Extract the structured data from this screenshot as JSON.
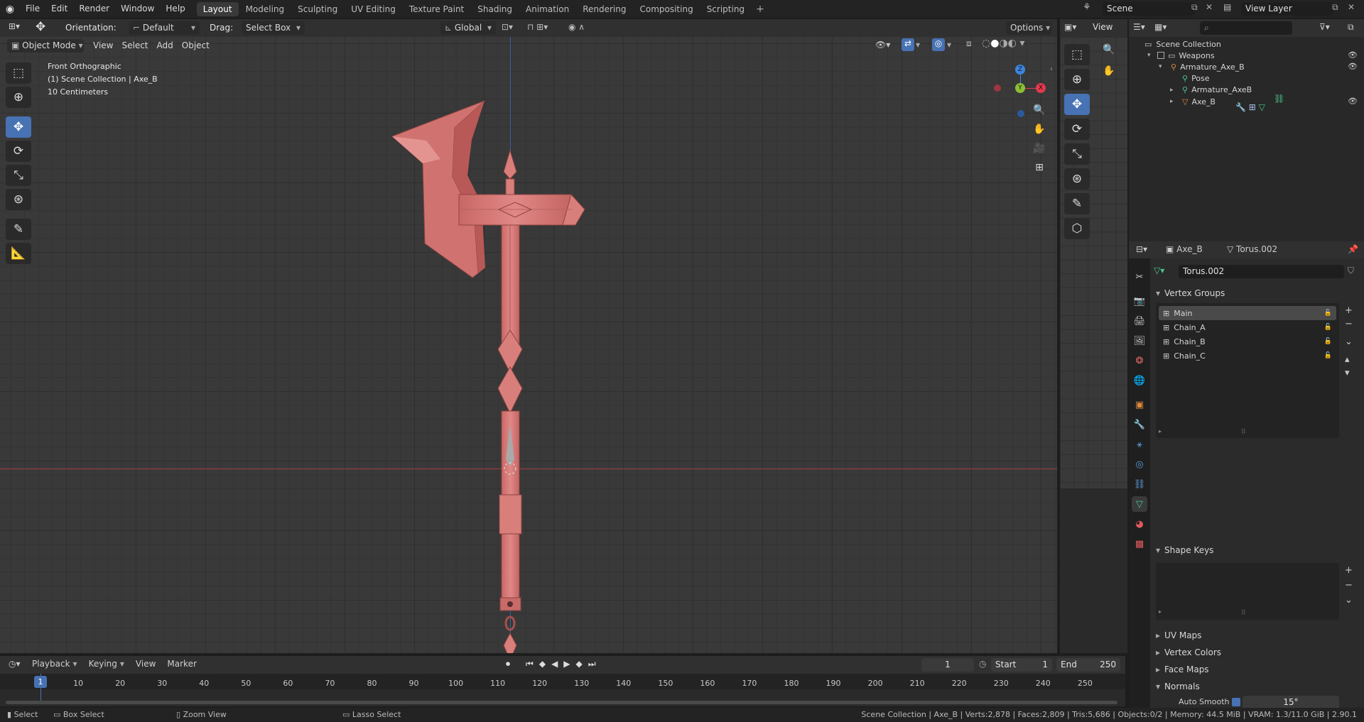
{
  "topbar": {
    "menus": [
      "File",
      "Edit",
      "Render",
      "Window",
      "Help"
    ],
    "workspaces": [
      "Layout",
      "Modeling",
      "Sculpting",
      "UV Editing",
      "Texture Paint",
      "Shading",
      "Animation",
      "Rendering",
      "Compositing",
      "Scripting"
    ],
    "active_workspace": "Layout",
    "add_tab": "+",
    "scene_name": "Scene",
    "view_layer": "View Layer"
  },
  "viewport_header": {
    "orientation_label": "Orientation:",
    "orientation_value": "Default",
    "drag_label": "Drag:",
    "drag_value": "Select Box",
    "transform_orientation": "Global",
    "options": "Options",
    "mode": "Object Mode",
    "menus": [
      "View",
      "Select",
      "Add",
      "Object"
    ]
  },
  "viewport_overlay": {
    "view_name": "Front Orthographic",
    "collection_info": "(1) Scene Collection | Axe_B",
    "scale": "10 Centimeters"
  },
  "gizmo": {
    "z": "Z",
    "y": "Y",
    "x": "X"
  },
  "side_header": {
    "view": "View"
  },
  "outliner": {
    "root": "Scene Collection",
    "items": [
      {
        "label": "Weapons",
        "indent": 1
      },
      {
        "label": "Armature_Axe_B",
        "indent": 2
      },
      {
        "label": "Pose",
        "indent": 3
      },
      {
        "label": "Armature_AxeB",
        "indent": 3
      },
      {
        "label": "Axe_B",
        "indent": 3
      }
    ]
  },
  "properties": {
    "object_name": "Axe_B",
    "mesh_name": "Torus.002",
    "mesh_field": "Torus.002",
    "vertex_groups_title": "Vertex Groups",
    "vertex_groups": [
      "Main",
      "Chain_A",
      "Chain_B",
      "Chain_C"
    ],
    "selected_vertex_group": 0,
    "shape_keys_title": "Shape Keys",
    "collapsed_sections": [
      "UV Maps",
      "Vertex Colors",
      "Face Maps"
    ],
    "normals_title": "Normals",
    "auto_smooth_label": "Auto Smooth",
    "auto_smooth_angle": "15°"
  },
  "timeline": {
    "menus": [
      "Playback",
      "Keying",
      "View",
      "Marker"
    ],
    "current_frame": "1",
    "start_label": "Start",
    "start": "1",
    "end_label": "End",
    "end": "250",
    "ruler": [
      "1",
      "10",
      "20",
      "30",
      "40",
      "50",
      "60",
      "70",
      "80",
      "90",
      "100",
      "110",
      "120",
      "130",
      "140",
      "150",
      "160",
      "170",
      "180",
      "190",
      "200",
      "210",
      "220",
      "230",
      "240",
      "250"
    ]
  },
  "statusbar": {
    "select": "Select",
    "box_select": "Box Select",
    "zoom_view": "Zoom View",
    "lasso_select": "Lasso Select",
    "stats": "Scene Collection | Axe_B | Verts:2,878 | Faces:2,809 | Tris:5,686 | Objects:0/2 | Memory: 44.5 MiB | VRAM: 1.3/11.0 GiB | 2.90.1"
  },
  "colors": {
    "accent": "#4772b3",
    "mesh": "#d97f7b",
    "x_axis": "#e3394c",
    "y_axis": "#8bbf35",
    "z_axis": "#3c85dd"
  }
}
